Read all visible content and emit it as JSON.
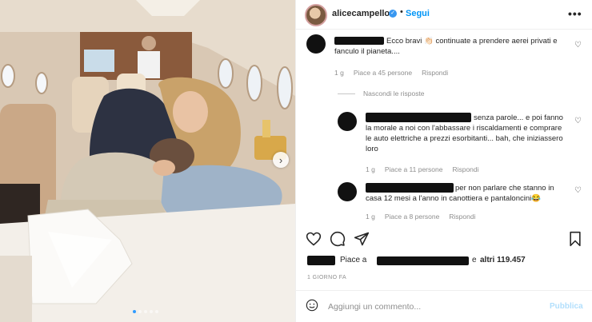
{
  "post": {
    "username": "alicecampello",
    "follow_label": "Segui",
    "bullet": "•",
    "more_icon": "more-horizontal-icon"
  },
  "comments": [
    {
      "text": "Ecco bravi 👏🏻 continuate a prendere aerei privati e fanculo il pianeta....",
      "age": "1 g",
      "likes": "Piace a 45 persone",
      "reply": "Rispondi"
    }
  ],
  "hide_replies_label": "Nascondi le risposte",
  "replies": [
    {
      "text": "senza parole... e poi fanno la morale a noi con l'abbassare i riscaldamenti e comprare le auto elettriche a prezzi esorbitanti... bah, che iniziassero loro",
      "age": "1 g",
      "likes": "Piace a 11 persone",
      "reply": "Rispondi"
    },
    {
      "text": "per non parlare che stanno in casa 12 mesi a l'anno in canottiera e pantaloncini😂",
      "age": "1 g",
      "likes": "Piace a 8 persone",
      "reply": "Rispondi"
    }
  ],
  "likes_summary": {
    "prefix": "Piace a",
    "suffix": "e",
    "others": "altri 119.457"
  },
  "timestamp": "1 GIORNO FA",
  "add_comment": {
    "placeholder": "Aggiungi un commento...",
    "publish_label": "Pubblica"
  },
  "carousel": {
    "slides": 5,
    "active": 1
  },
  "colors": {
    "follow": "#0095f6",
    "publish_disabled": "#b2dffc",
    "verified": "#3897f0"
  }
}
